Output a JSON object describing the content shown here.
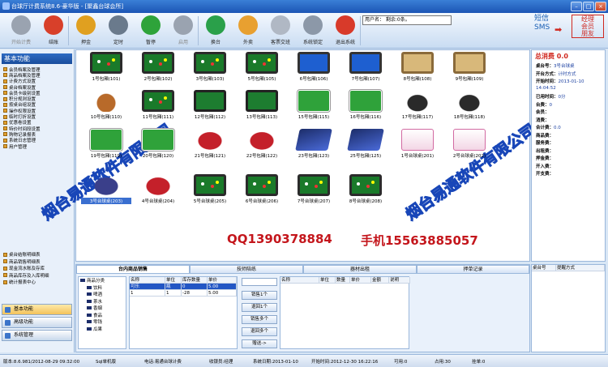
{
  "window": {
    "title": "台球厅计费系统8.6-豪华版 - [聚鑫台球会所]"
  },
  "toolbar": {
    "buttons": [
      {
        "label": "开始计费",
        "icon": "play-icon",
        "color": "#9aa3b0",
        "disabled": true
      },
      {
        "label": "结账",
        "icon": "record-icon",
        "color": "#d8402a"
      },
      {
        "label": "押金",
        "icon": "deposit-icon",
        "color": "#e0a020"
      },
      {
        "label": "定时",
        "icon": "timer-icon",
        "color": "#6a7a8c"
      },
      {
        "label": "暂停",
        "icon": "pause-icon",
        "color": "#2ea33a"
      },
      {
        "label": "启用",
        "icon": "enable-icon",
        "color": "#9aa3b0",
        "disabled": true
      },
      {
        "label": "换台",
        "icon": "switch-icon",
        "color": "#2aa04a"
      },
      {
        "label": "外卖",
        "icon": "takeout-icon",
        "color": "#e8a030"
      },
      {
        "label": "客票交班",
        "icon": "ticket-icon",
        "color": "#b0b8c4"
      },
      {
        "label": "系统锁定",
        "icon": "lock-icon",
        "color": "#8c98a8"
      },
      {
        "label": "退出系统",
        "icon": "exit-icon",
        "color": "#d83a2a"
      }
    ],
    "user_box": "用户名：  剩余:0条。",
    "sms": [
      "短信",
      "SMS"
    ],
    "manager": [
      "经理",
      "会员",
      "朋友"
    ]
  },
  "left": {
    "header": "基本功能",
    "items": [
      "会员档案及管理",
      "商品档案及管理",
      "计费方式设置",
      "桌台档案设置",
      "会员卡级别设置",
      "积分规则设置",
      "按桌台组设置",
      "操作权限设置",
      "临时打折设置",
      "优惠卷设置",
      "特价时间段设置",
      "购物记录报表",
      "系统日志管理",
      "用户管理"
    ],
    "items2": [
      "桌台结账明细表",
      "商品销售明细表",
      "现金流水账及存库",
      "商品库存及入库明细",
      "统计报表中心"
    ],
    "bottom_buttons": [
      "基本功能",
      "高级功能",
      "系统管理"
    ]
  },
  "tables": [
    {
      "label": "1号包厢(101)",
      "kind": "billiard"
    },
    {
      "label": "2号包厢(102)",
      "kind": "billiard"
    },
    {
      "label": "3号包厢(103)",
      "kind": "billiard"
    },
    {
      "label": "5号包厢(105)",
      "kind": "billiard"
    },
    {
      "label": "6号包厢(106)",
      "kind": "bluetable"
    },
    {
      "label": "7号包厢(107)",
      "kind": "bluetable"
    },
    {
      "label": "8号包厢(108)",
      "kind": "snooker"
    },
    {
      "label": "9号包厢(109)",
      "kind": "snooker"
    },
    {
      "label": "10号包厢(110)",
      "kind": "teapot"
    },
    {
      "label": "11号包厢(111)",
      "kind": "billiard"
    },
    {
      "label": "12号包厢(112)",
      "kind": "table2"
    },
    {
      "label": "13号包厢(113)",
      "kind": "table2"
    },
    {
      "label": "15号包厢(115)",
      "kind": "court"
    },
    {
      "label": "16号包厢(116)",
      "kind": "court"
    },
    {
      "label": "17号包厢(117)",
      "kind": "skate"
    },
    {
      "label": "18号包厢(118)",
      "kind": "skate"
    },
    {
      "label": "19号包厢(119)",
      "kind": "court"
    },
    {
      "label": "20号包厢(120)",
      "kind": "court"
    },
    {
      "label": "21号包厢(121)",
      "kind": "pad"
    },
    {
      "label": "22号包厢(122)",
      "kind": "pad"
    },
    {
      "label": "23号包厢(123)",
      "kind": "ps"
    },
    {
      "label": "25号包厢(125)",
      "kind": "ps"
    },
    {
      "label": "1号台球桌(201)",
      "kind": "wii"
    },
    {
      "label": "2号台球桌(202)",
      "kind": "wii"
    },
    {
      "label": "3号台球桌(203)",
      "kind": "padblue",
      "selected": true
    },
    {
      "label": "4号台球桌(204)",
      "kind": "pad"
    },
    {
      "label": "5号台球桌(205)",
      "kind": "billiard"
    },
    {
      "label": "6号台球桌(206)",
      "kind": "billiard"
    },
    {
      "label": "7号台球桌(207)",
      "kind": "billiard"
    },
    {
      "label": "8号台球桌(208)",
      "kind": "billiard"
    }
  ],
  "watermark": "烟台易通软件有限公司",
  "contact": {
    "qq": "QQ1390378884",
    "phone": "手机15563885057"
  },
  "info": {
    "total": "总消费 0.0",
    "rows": [
      {
        "k": "桌台号：",
        "v": "3号台球桌"
      },
      {
        "k": "开台方式：",
        "v": "计时方式"
      },
      {
        "k": "开始时间：",
        "v": "2013-01-10"
      },
      {
        "k": "",
        "v": "14:04:52"
      },
      {
        "k": "已用时间：",
        "v": "0分"
      },
      {
        "k": "台费：",
        "v": "0"
      },
      {
        "k": "会员：",
        "v": ""
      },
      {
        "k": "消费：",
        "v": ""
      },
      {
        "k": "合计费：",
        "v": "0.0"
      },
      {
        "k": "商品费：",
        "v": ""
      },
      {
        "k": "服务费：",
        "v": ""
      },
      {
        "k": "出租费：",
        "v": ""
      },
      {
        "k": "押金费：",
        "v": ""
      },
      {
        "k": "开入费：",
        "v": ""
      },
      {
        "k": "开支费：",
        "v": ""
      }
    ]
  },
  "bottom": {
    "tabs": [
      "台内商品销售",
      "技师陪练",
      "器材出租",
      "押单记录"
    ],
    "tree": [
      "商品分类",
      "饮料",
      "啤酒",
      "茶水",
      "香烟",
      "食品",
      "零钱",
      "瓜果"
    ],
    "goods_headers": [
      "名称",
      "单位",
      "库存数量",
      "单价"
    ],
    "goods_rows": [
      [
        "可乐",
        "瓶",
        "0",
        "5.00"
      ],
      [
        "1",
        "1",
        "-28",
        "5.00"
      ]
    ],
    "actions": [
      "销售1个",
      "退回1个",
      "销售多个",
      "退回多个",
      "赠送->"
    ],
    "sold_headers": [
      "名称",
      "单位",
      "数量",
      "单价",
      "金额",
      "说明"
    ],
    "right_headers": [
      "桌台号",
      "提醒方式"
    ]
  },
  "status": [
    "版本:8.6.981/2012-08-29 09:32:00",
    "Sql单机版",
    "电话:易通台球计费",
    "收银员:经理",
    "系统日期:2013-01-10",
    "开始时间:2012-12-30 16:22:16",
    "可用:0",
    "占用:30",
    "挂单:0"
  ]
}
